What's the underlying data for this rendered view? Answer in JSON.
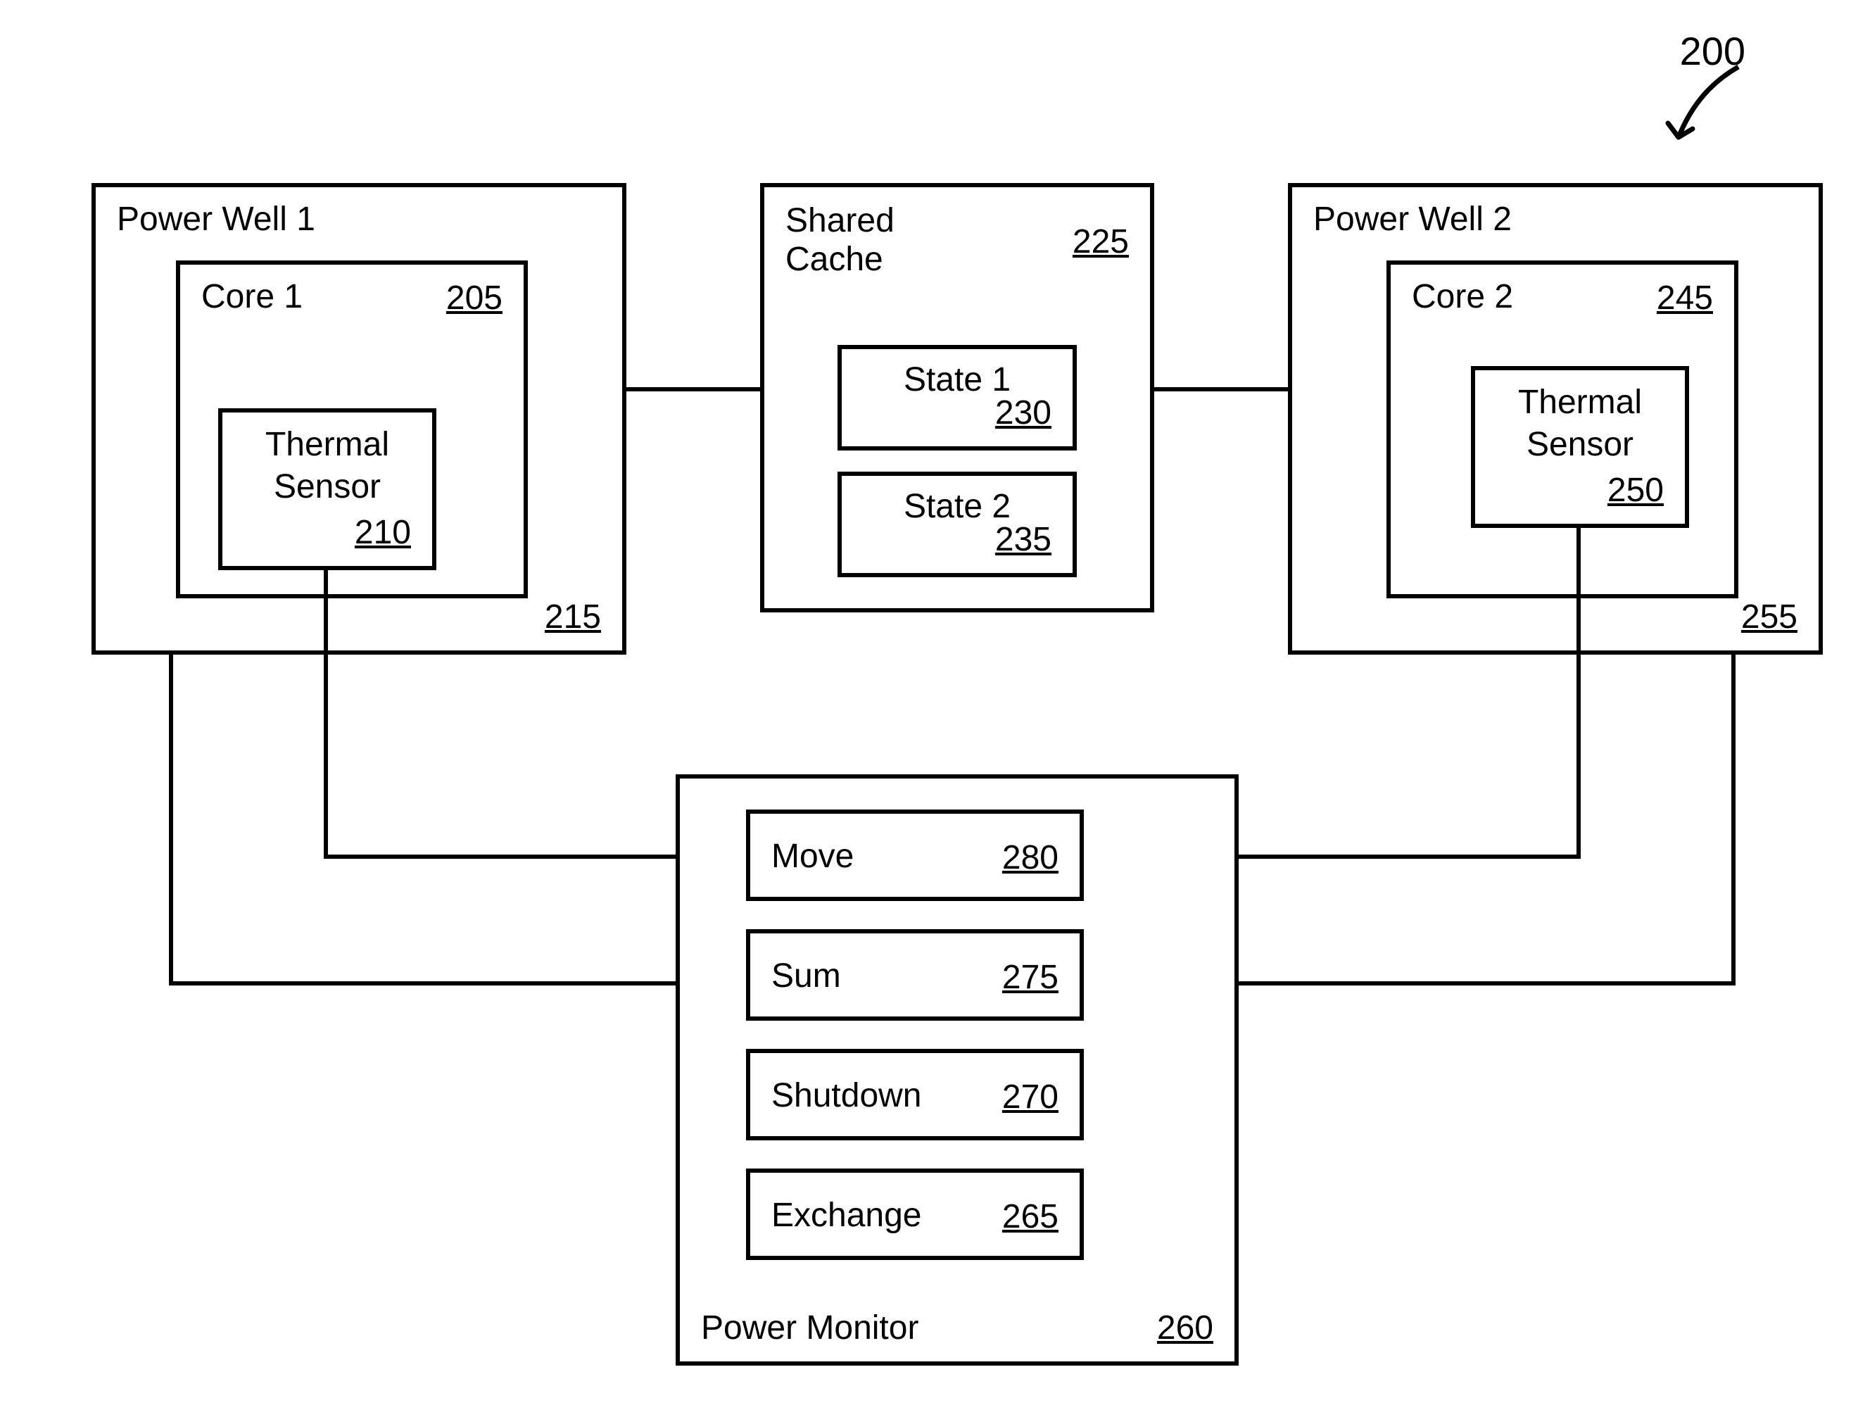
{
  "figure_ref": "200",
  "power_well_1": {
    "label": "Power Well 1",
    "ref": "215"
  },
  "core_1": {
    "label": "Core 1",
    "ref": "205"
  },
  "thermal_sensor_1": {
    "line1": "Thermal",
    "line2": "Sensor",
    "ref": "210"
  },
  "shared_cache": {
    "line1": "Shared",
    "line2": "Cache",
    "ref": "225"
  },
  "state_1": {
    "label": "State 1",
    "ref": "230"
  },
  "state_2": {
    "label": "State 2",
    "ref": "235"
  },
  "power_well_2": {
    "label": "Power Well 2",
    "ref": "255"
  },
  "core_2": {
    "label": "Core 2",
    "ref": "245"
  },
  "thermal_sensor_2": {
    "line1": "Thermal",
    "line2": "Sensor",
    "ref": "250"
  },
  "power_monitor": {
    "label": "Power Monitor",
    "ref": "260"
  },
  "move": {
    "label": "Move",
    "ref": "280"
  },
  "sum": {
    "label": "Sum",
    "ref": "275"
  },
  "shutdown": {
    "label": "Shutdown",
    "ref": "270"
  },
  "exchange": {
    "label": "Exchange",
    "ref": "265"
  }
}
